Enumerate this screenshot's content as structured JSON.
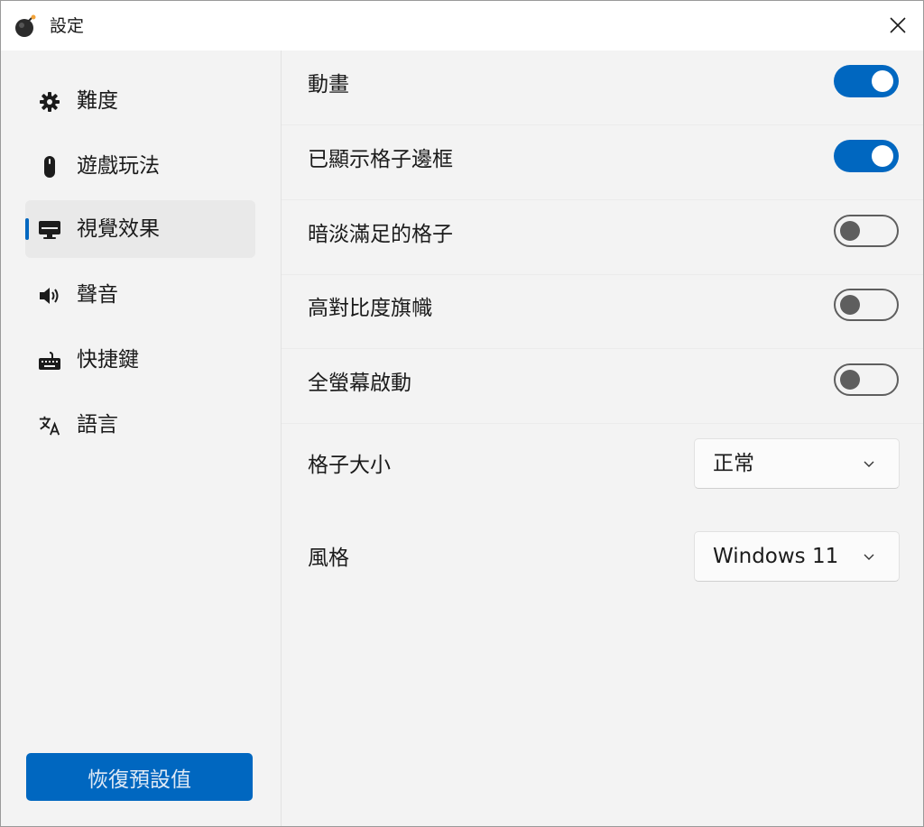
{
  "window": {
    "title": "設定",
    "close_icon": "close-icon",
    "app_icon": "bomb-icon"
  },
  "sidebar": {
    "items": [
      {
        "label": "難度",
        "icon": "gear-icon",
        "active": false
      },
      {
        "label": "遊戲玩法",
        "icon": "mouse-icon",
        "active": false
      },
      {
        "label": "視覺效果",
        "icon": "monitor-icon",
        "active": true
      },
      {
        "label": "聲音",
        "icon": "speaker-icon",
        "active": false
      },
      {
        "label": "快捷鍵",
        "icon": "keyboard-icon",
        "active": false
      },
      {
        "label": "語言",
        "icon": "translate-icon",
        "active": false
      }
    ],
    "reset_label": "恢復預設值"
  },
  "settings": {
    "toggles": [
      {
        "label": "動畫",
        "on": true
      },
      {
        "label": "已顯示格子邊框",
        "on": true
      },
      {
        "label": "暗淡滿足的格子",
        "on": false
      },
      {
        "label": "高對比度旗幟",
        "on": false
      },
      {
        "label": "全螢幕啟動",
        "on": false
      }
    ],
    "selects": [
      {
        "label": "格子大小",
        "value": "正常"
      },
      {
        "label": "風格",
        "value": "Windows 11"
      }
    ]
  },
  "colors": {
    "accent": "#0067c0",
    "background": "#f3f3f3"
  }
}
